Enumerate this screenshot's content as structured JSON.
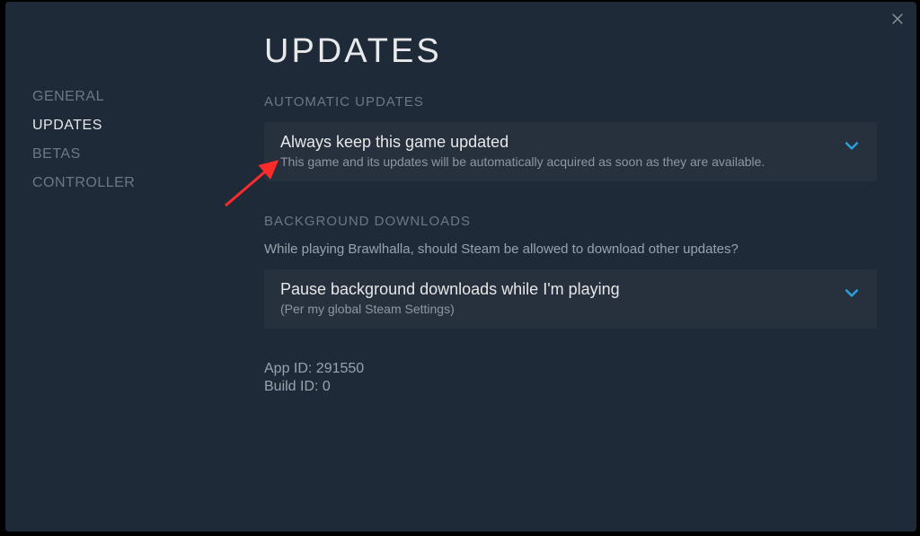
{
  "sidebar": {
    "items": [
      {
        "label": "GENERAL"
      },
      {
        "label": "UPDATES"
      },
      {
        "label": "BETAS"
      },
      {
        "label": "CONTROLLER"
      }
    ]
  },
  "page": {
    "title": "UPDATES",
    "section1": {
      "header": "AUTOMATIC UPDATES",
      "dropdown": {
        "label": "Always keep this game updated",
        "sub": "This game and its updates will be automatically acquired as soon as they are available."
      }
    },
    "section2": {
      "header": "BACKGROUND DOWNLOADS",
      "desc": "While playing Brawlhalla, should Steam be allowed to download other updates?",
      "dropdown": {
        "label": "Pause background downloads while I'm playing",
        "sub": "(Per my global Steam Settings)"
      }
    },
    "info": {
      "appid": "App ID: 291550",
      "buildid": "Build ID: 0"
    }
  }
}
